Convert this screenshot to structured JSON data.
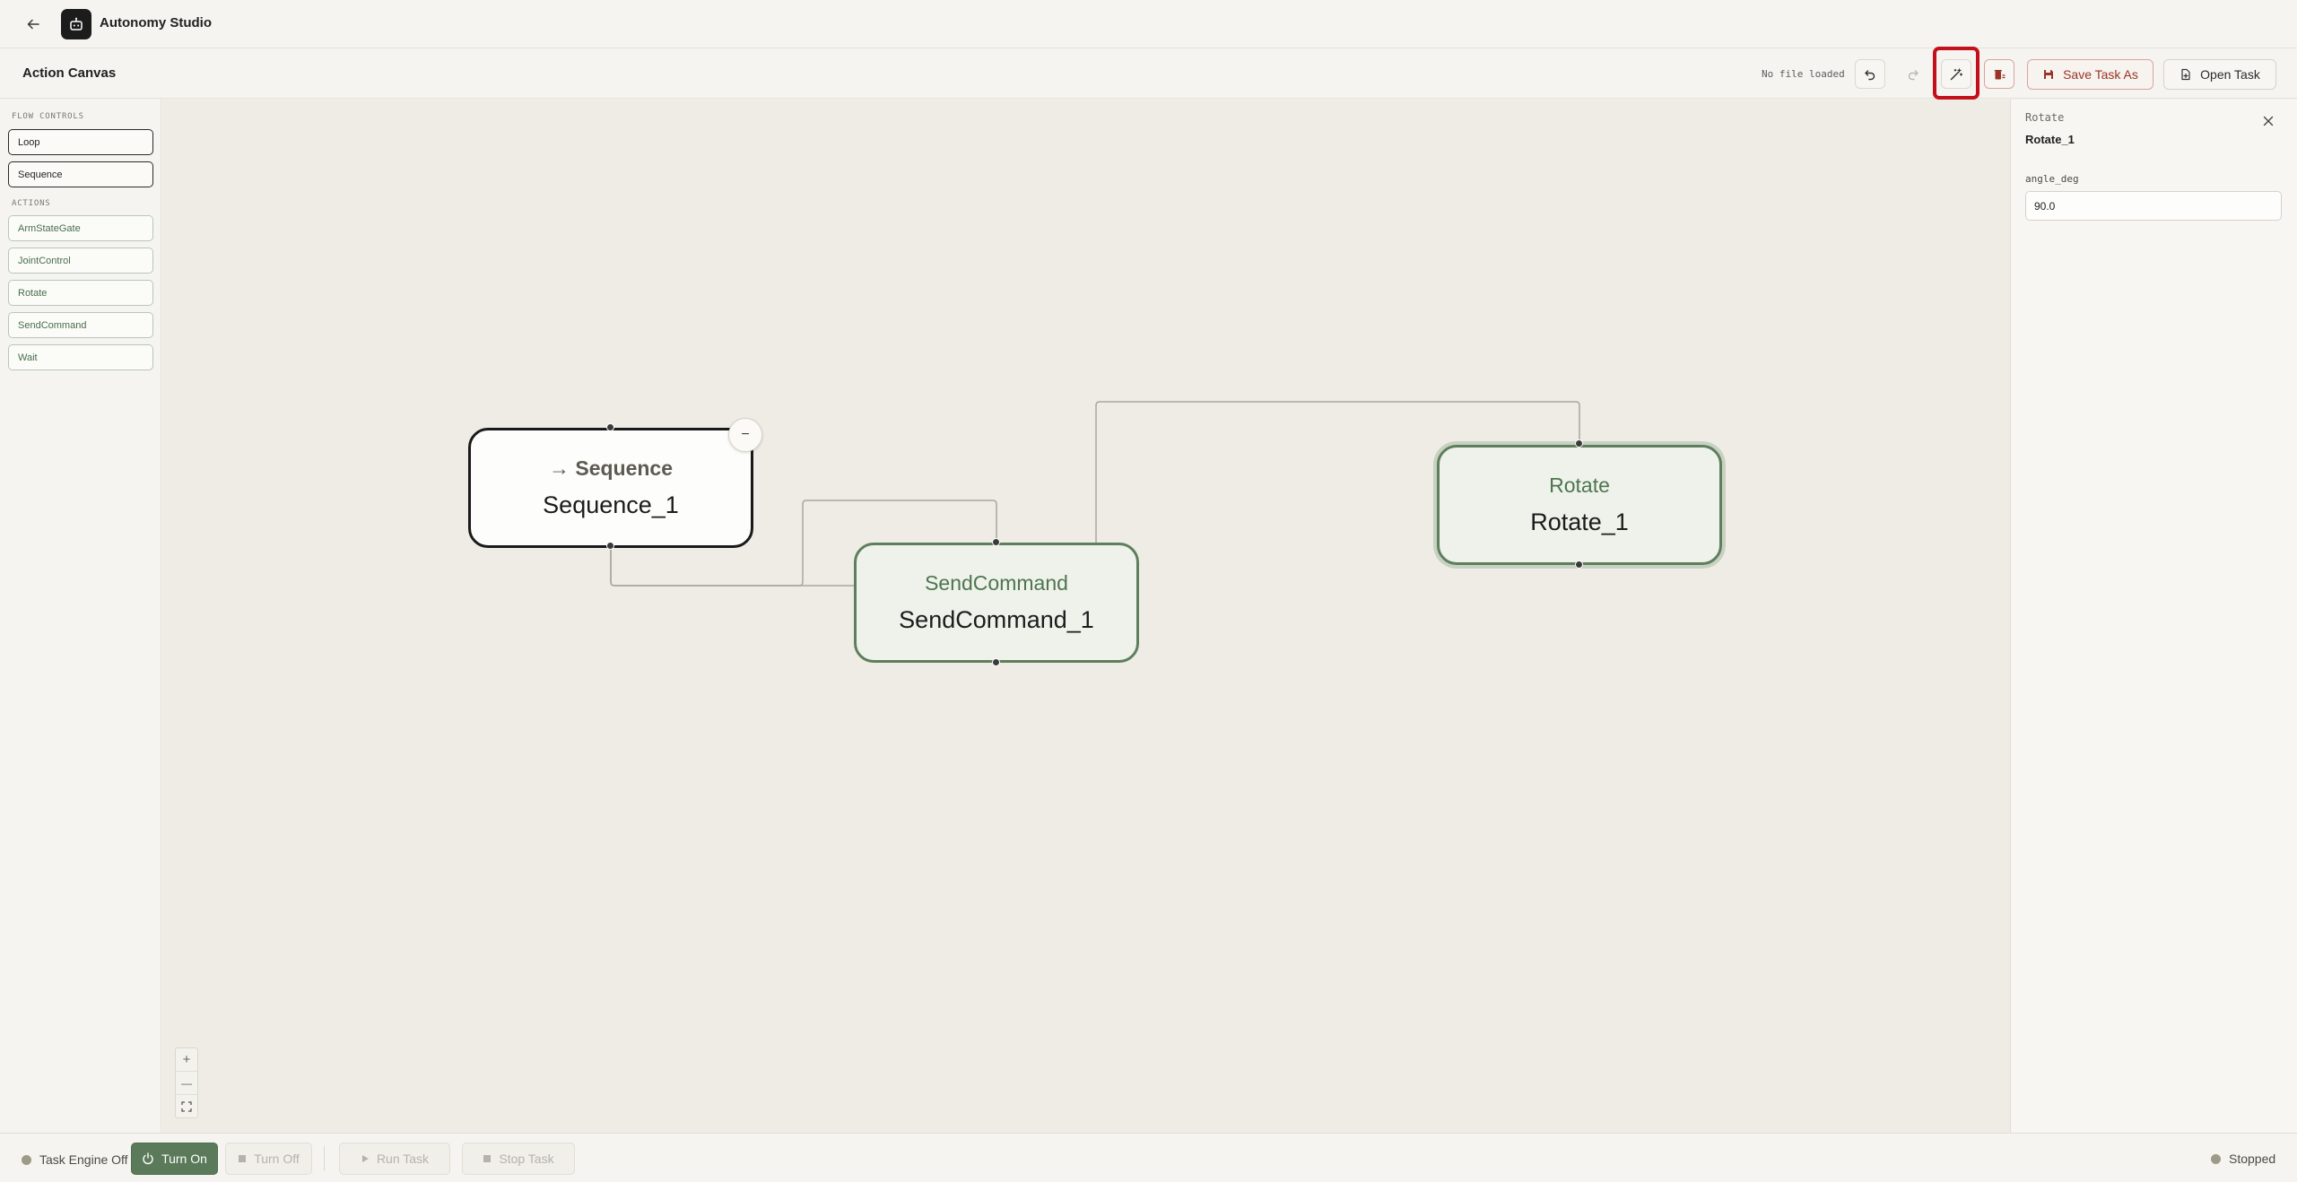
{
  "app": {
    "title": "Autonomy Studio"
  },
  "toolbar": {
    "title": "Action Canvas",
    "file_status": "No file loaded",
    "save_label": "Save Task As",
    "open_label": "Open Task"
  },
  "palette": {
    "flow_label": "FLOW CONTROLS",
    "flow_items": [
      "Loop",
      "Sequence"
    ],
    "actions_label": "ACTIONS",
    "action_items": [
      "ArmStateGate",
      "JointControl",
      "Rotate",
      "SendCommand",
      "Wait"
    ]
  },
  "canvas": {
    "nodes": [
      {
        "type_arrow": "→",
        "type": "Sequence",
        "name": "Sequence_1",
        "kind": "flow"
      },
      {
        "type": "SendCommand",
        "name": "SendCommand_1",
        "kind": "action"
      },
      {
        "type": "Rotate",
        "name": "Rotate_1",
        "kind": "action",
        "selected": true
      }
    ],
    "collapse_symbol": "−",
    "zoom": {
      "in": "+",
      "out": "—"
    }
  },
  "inspector": {
    "node_type": "Rotate",
    "node_name": "Rotate_1",
    "field_label": "angle_deg",
    "field_value": "90.0"
  },
  "status_bar": {
    "engine_status": "Task Engine Off",
    "turn_on": "Turn On",
    "turn_off": "Turn Off",
    "run_task": "Run Task",
    "stop_task": "Stop Task",
    "run_status": "Stopped"
  },
  "colors": {
    "accent_green": "#5b7a5a",
    "danger": "#9a3427",
    "highlight": "#c4101a"
  }
}
